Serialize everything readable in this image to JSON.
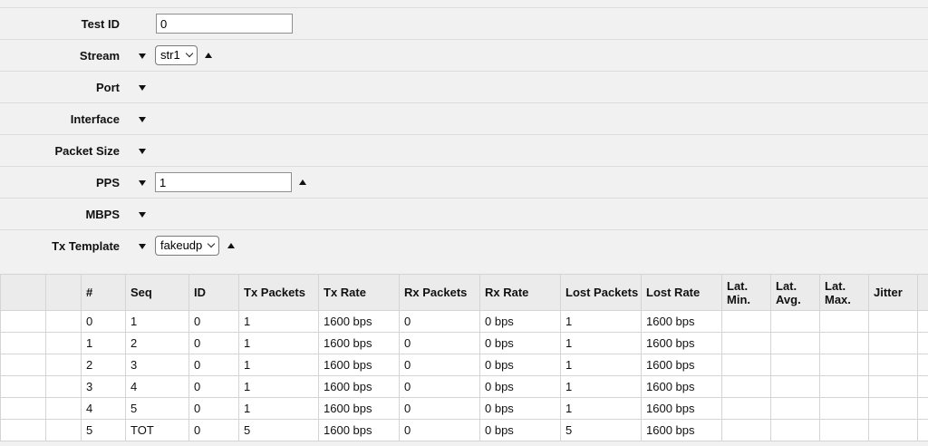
{
  "form": {
    "test_id": {
      "label": "Test ID",
      "value": "0"
    },
    "stream": {
      "label": "Stream",
      "value": "str1"
    },
    "port": {
      "label": "Port"
    },
    "interface": {
      "label": "Interface"
    },
    "packet_size": {
      "label": "Packet Size"
    },
    "pps": {
      "label": "PPS",
      "value": "1"
    },
    "mbps": {
      "label": "MBPS"
    },
    "tx_template": {
      "label": "Tx Template",
      "value": "fakeudp"
    }
  },
  "table": {
    "headers": [
      "#",
      "Seq",
      "ID",
      "Tx Packets",
      "Tx Rate",
      "Rx Packets",
      "Rx Rate",
      "Lost Packets",
      "Lost Rate",
      "Lat. Min.",
      "Lat. Avg.",
      "Lat. Max.",
      "Jitter"
    ],
    "rows": [
      [
        "0",
        "1",
        "0",
        "1",
        "1600 bps",
        "0",
        "0 bps",
        "1",
        "1600 bps",
        "",
        "",
        "",
        ""
      ],
      [
        "1",
        "2",
        "0",
        "1",
        "1600 bps",
        "0",
        "0 bps",
        "1",
        "1600 bps",
        "",
        "",
        "",
        ""
      ],
      [
        "2",
        "3",
        "0",
        "1",
        "1600 bps",
        "0",
        "0 bps",
        "1",
        "1600 bps",
        "",
        "",
        "",
        ""
      ],
      [
        "3",
        "4",
        "0",
        "1",
        "1600 bps",
        "0",
        "0 bps",
        "1",
        "1600 bps",
        "",
        "",
        "",
        ""
      ],
      [
        "4",
        "5",
        "0",
        "1",
        "1600 bps",
        "0",
        "0 bps",
        "1",
        "1600 bps",
        "",
        "",
        "",
        ""
      ],
      [
        "5",
        "TOT",
        "0",
        "5",
        "1600 bps",
        "0",
        "0 bps",
        "5",
        "1600 bps",
        "",
        "",
        "",
        ""
      ]
    ]
  },
  "icons": {
    "collapse": "triangle-down-icon",
    "expand": "triangle-up-icon",
    "select": "chevron-down-icon"
  }
}
